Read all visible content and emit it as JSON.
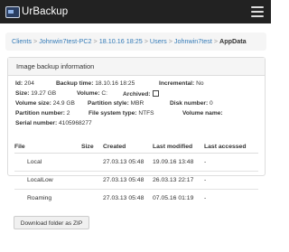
{
  "navbar": {
    "brand": "UrBackup"
  },
  "breadcrumb": {
    "items": [
      "Clients",
      "Johnwin7test-PC2",
      "18.10.16 18:25",
      "Users",
      "Johnwin7test"
    ],
    "active": "AppData",
    "separator": ">"
  },
  "panel": {
    "title": "Image backup information",
    "fields": {
      "id": {
        "label": "Id:",
        "value": "204"
      },
      "backup_time": {
        "label": "Backup time:",
        "value": "18.10.16 18:25"
      },
      "incremental": {
        "label": "Incremental:",
        "value": "No"
      },
      "size": {
        "label": "Size:",
        "value": "19.27 GB"
      },
      "volume": {
        "label": "Volume:",
        "value": "C:"
      },
      "archived": {
        "label": "Archived:",
        "value": ""
      },
      "volume_size": {
        "label": "Volume size:",
        "value": "24.9 GB"
      },
      "partition_style": {
        "label": "Partition style:",
        "value": "MBR"
      },
      "disk_number": {
        "label": "Disk number:",
        "value": "0"
      },
      "partition_number": {
        "label": "Partition number:",
        "value": "2"
      },
      "file_system_type": {
        "label": "File system type:",
        "value": "NTFS"
      },
      "volume_name": {
        "label": "Volume name:",
        "value": ""
      },
      "serial_number": {
        "label": "Serial number:",
        "value": "4105968277"
      }
    }
  },
  "table": {
    "headers": {
      "file": "File",
      "size": "Size",
      "created": "Created",
      "last_modified": "Last modified",
      "last_accessed": "Last accessed"
    },
    "rows": [
      {
        "file": "Local",
        "size": "",
        "created": "27.03.13 05:48",
        "last_modified": "19.09.16 13:48",
        "last_accessed": "-"
      },
      {
        "file": "LocalLow",
        "size": "",
        "created": "27.03.13 05:48",
        "last_modified": "26.03.13 22:17",
        "last_accessed": "-"
      },
      {
        "file": "Roaming",
        "size": "",
        "created": "27.03.13 05:48",
        "last_modified": "07.05.16 01:19",
        "last_accessed": "-"
      }
    ]
  },
  "actions": {
    "download_zip": "Download folder as ZIP"
  },
  "colors": {
    "navbar": "#222222",
    "link": "#337ab7",
    "panel_heading": "#f5f5f5"
  },
  "icons": {
    "logo": "urbackup-logo-icon",
    "menu": "hamburger-menu-icon"
  }
}
